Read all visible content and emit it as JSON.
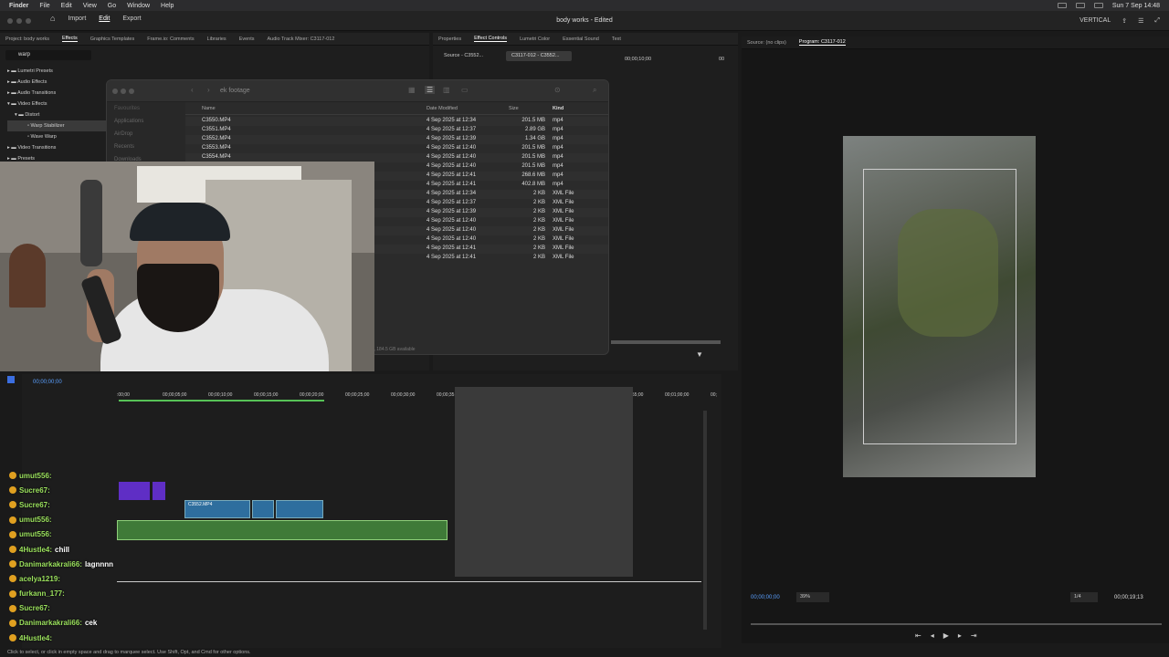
{
  "menubar": {
    "app": "Finder",
    "items": [
      "File",
      "Edit",
      "View",
      "Go",
      "Window",
      "Help"
    ],
    "clock": "Sun 7 Sep 14:48"
  },
  "titlebar": {
    "nav": [
      "Import",
      "Edit",
      "Export"
    ],
    "active": "Edit",
    "title": "body works - Edited",
    "workspace": "VERTICAL"
  },
  "project_tabs": [
    "Project: body works",
    "Effects",
    "Graphics Templates",
    "Frame.io: Comments",
    "Libraries",
    "Events",
    "Audio Track Mixer: C3117-012"
  ],
  "effects": {
    "search": "warp",
    "tree": [
      "Lumetri Presets",
      "Audio Effects",
      "Audio Transitions",
      "Video Effects",
      "Distort",
      "Warp Stabilizer",
      "Wave Warp",
      "Video Transitions",
      "Presets"
    ]
  },
  "effect_tabs": [
    "Properties",
    "Effect Controls",
    "Lumetri Color",
    "Essential Sound",
    "Text"
  ],
  "effect_controls": {
    "source": "Source - C3552...",
    "clip": "C3117-012 - C3552...",
    "time": "00;00;10;00",
    "end": "00"
  },
  "finder": {
    "folder": "ek footage",
    "sidebar": [
      "Favourites",
      "Applications",
      "AirDrop",
      "Recents",
      "Downloads"
    ],
    "columns": [
      "Name",
      "Date Modified",
      "Size",
      "Kind"
    ],
    "rows": [
      [
        "C3550.MP4",
        "4 Sep 2025 at 12:34",
        "201.5 MB",
        "mp4"
      ],
      [
        "C3551.MP4",
        "4 Sep 2025 at 12:37",
        "2.89 GB",
        "mp4"
      ],
      [
        "C3552.MP4",
        "4 Sep 2025 at 12:39",
        "1.34 GB",
        "mp4"
      ],
      [
        "C3553.MP4",
        "4 Sep 2025 at 12:40",
        "201.5 MB",
        "mp4"
      ],
      [
        "C3554.MP4",
        "4 Sep 2025 at 12:40",
        "201.5 MB",
        "mp4"
      ],
      [
        "",
        "4 Sep 2025 at 12:40",
        "201.5 MB",
        "mp4"
      ],
      [
        "",
        "4 Sep 2025 at 12:41",
        "268.6 MB",
        "mp4"
      ],
      [
        "",
        "4 Sep 2025 at 12:41",
        "402.8 MB",
        "mp4"
      ],
      [
        "",
        "4 Sep 2025 at 12:34",
        "2 KB",
        "XML File"
      ],
      [
        "",
        "4 Sep 2025 at 12:37",
        "2 KB",
        "XML File"
      ],
      [
        "",
        "4 Sep 2025 at 12:39",
        "2 KB",
        "XML File"
      ],
      [
        "",
        "4 Sep 2025 at 12:40",
        "2 KB",
        "XML File"
      ],
      [
        "",
        "4 Sep 2025 at 12:40",
        "2 KB",
        "XML File"
      ],
      [
        "",
        "4 Sep 2025 at 12:40",
        "2 KB",
        "XML File"
      ],
      [
        "",
        "4 Sep 2025 at 12:41",
        "2 KB",
        "XML File"
      ],
      [
        "",
        "4 Sep 2025 at 12:41",
        "2 KB",
        "XML File"
      ]
    ],
    "footer": "s, 184.5 GB available"
  },
  "program": {
    "source_tab": "Source: (no clips)",
    "program_tab": "Program: C3117-012",
    "timecode": "00;00;00;00",
    "zoom": "39%",
    "quality": "1/4",
    "duration": "00;00;19;13"
  },
  "timeline": {
    "timecode": "00;00;00;00",
    "ruler": [
      ":00;00",
      "00;00;05;00",
      "00;00;10;00",
      "00;00;15;00",
      "00;00;20;00",
      "00;00;25;00",
      "00;00;30;00",
      "00;00;35;00",
      "00;00;40;00",
      "00;00;45;00",
      "00;00;50;00",
      "00;00;55;00",
      "00;01;00;00",
      "00;"
    ],
    "clip": "C3552.MP4"
  },
  "chat": [
    {
      "user": "umut556:",
      "msg": ""
    },
    {
      "user": "Sucre67:",
      "msg": ""
    },
    {
      "user": "Sucre67:",
      "msg": ""
    },
    {
      "user": "umut556:",
      "msg": ""
    },
    {
      "user": "umut556:",
      "msg": ""
    },
    {
      "user": "4Hustle4:",
      "msg": "chill"
    },
    {
      "user": "Danimarkakrali66:",
      "msg": "lagnnnn"
    },
    {
      "user": "acelya1219:",
      "msg": ""
    },
    {
      "user": "furkann_177:",
      "msg": ""
    },
    {
      "user": "Sucre67:",
      "msg": ""
    },
    {
      "user": "Danimarkakrali66:",
      "msg": "cek"
    },
    {
      "user": "4Hustle4:",
      "msg": ""
    }
  ],
  "status": "Click to select, or click in empty space and drag to marquee select. Use Shift, Opt, and Cmd for other options."
}
